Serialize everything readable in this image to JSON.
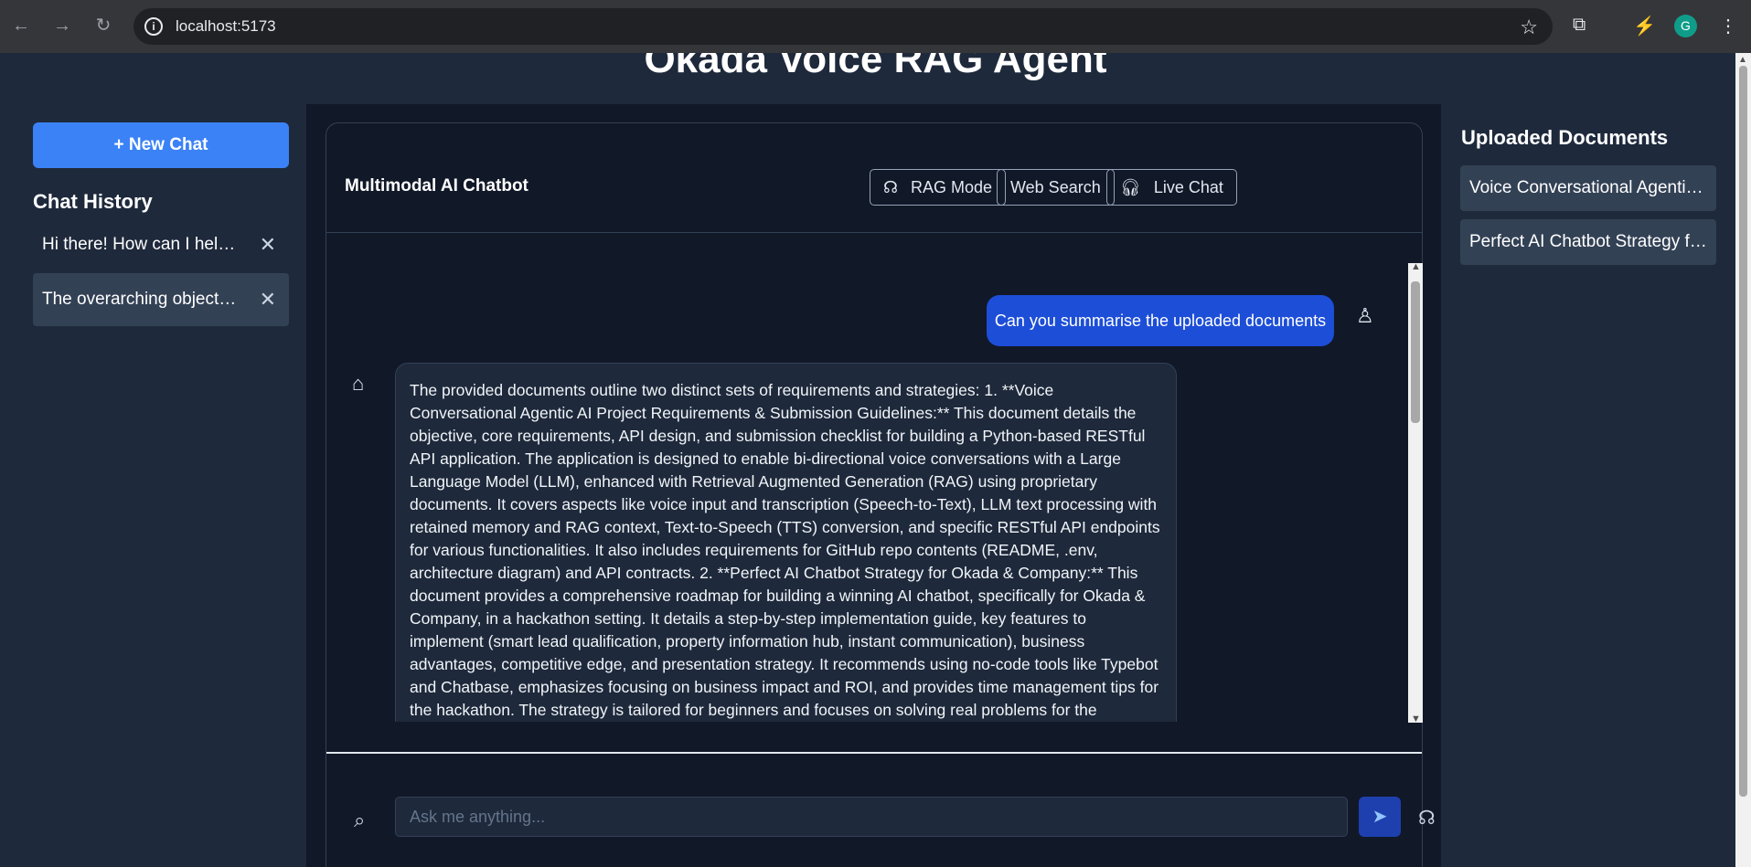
{
  "browser": {
    "url": "localhost:5173",
    "profile_initial": "G"
  },
  "app": {
    "title": "Okada Voice RAG Agent"
  },
  "sidebar": {
    "new_chat_label": "+ New Chat",
    "history_title": "Chat History",
    "items": [
      {
        "label": "Hi there! How can I help you today?"
      },
      {
        "label": "The overarching objective of the project"
      }
    ]
  },
  "chat": {
    "title": "Multimodal AI Chatbot",
    "modes": [
      {
        "label": "RAG Mode",
        "icon": "ear-icon"
      },
      {
        "label": "Web Search"
      },
      {
        "label": "Live Chat",
        "icon": "headphones-icon"
      }
    ],
    "user_message": "Can you summarise the uploaded documents",
    "bot_message": "The provided documents outline two distinct sets of requirements and strategies: 1. **Voice Conversational Agentic AI Project Requirements & Submission Guidelines:** This document details the objective, core requirements, API design, and submission checklist for building a Python-based RESTful API application. The application is designed to enable bi-directional voice conversations with a Large Language Model (LLM), enhanced with Retrieval Augmented Generation (RAG) using proprietary documents. It covers aspects like voice input and transcription (Speech-to-Text), LLM text processing with retained memory and RAG context, Text-to-Speech (TTS) conversion, and specific RESTful API endpoints for various functionalities. It also includes requirements for GitHub repo contents (README, .env, architecture diagram) and API contracts. 2. **Perfect AI Chatbot Strategy for Okada & Company:** This document provides a comprehensive roadmap for building a winning AI chatbot, specifically for Okada & Company, in a hackathon setting. It details a step-by-step implementation guide, key features to implement (smart lead qualification, property information hub, instant communication), business advantages, competitive edge, and presentation strategy. It recommends using no-code tools like Typebot and Chatbase, emphasizes focusing on business impact and ROI, and provides time management tips for the hackathon. The strategy is tailored for beginners and focuses on solving real problems for the",
    "input_placeholder": "Ask me anything..."
  },
  "documents": {
    "title": "Uploaded Documents",
    "items": [
      {
        "label": "Voice Conversational Agentic AI Project Requirements"
      },
      {
        "label": "Perfect AI Chatbot Strategy for Okada & Company"
      }
    ]
  }
}
